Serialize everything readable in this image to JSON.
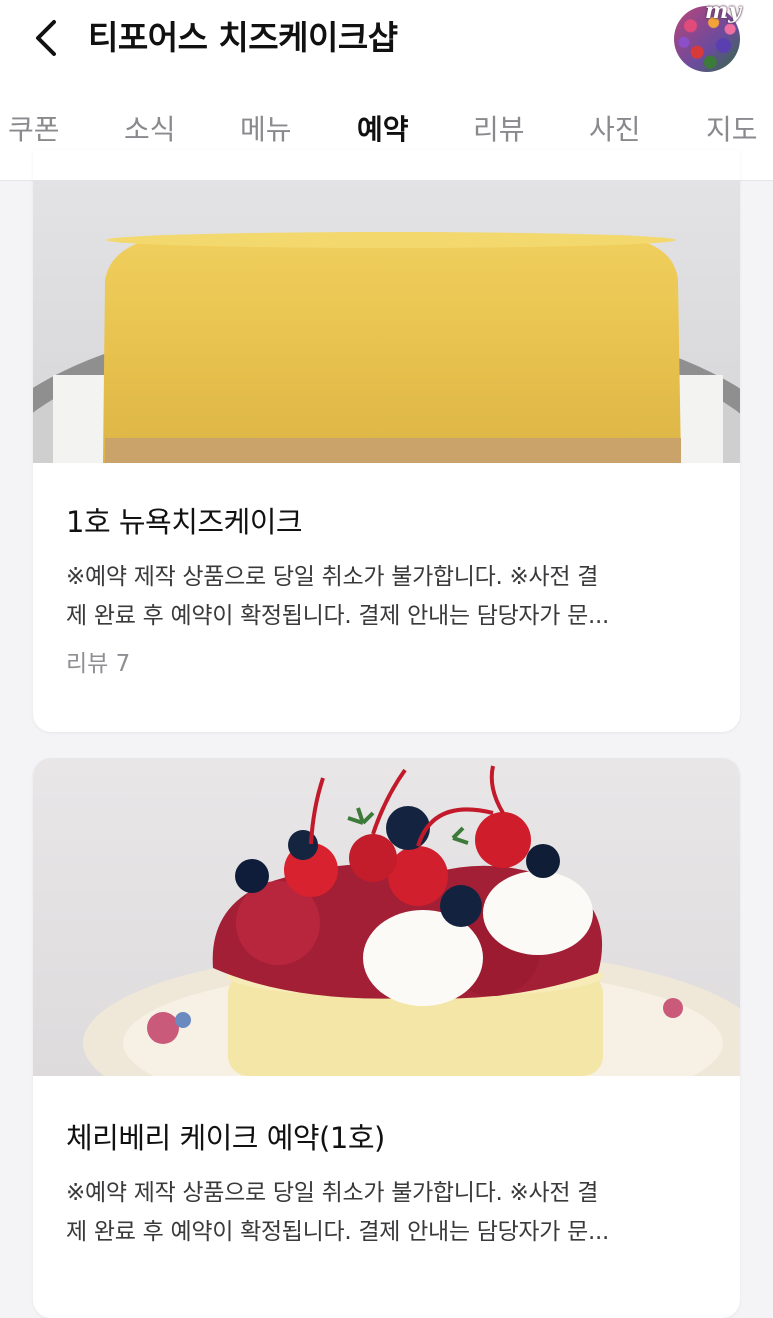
{
  "header": {
    "title": "티포어스 치즈케이크샵",
    "back_icon": "chevron-left-icon",
    "my_label": "my"
  },
  "tabs": [
    {
      "label": "쿠폰",
      "active": false
    },
    {
      "label": "소식",
      "active": false
    },
    {
      "label": "메뉴",
      "active": false
    },
    {
      "label": "예약",
      "active": true
    },
    {
      "label": "리뷰",
      "active": false
    },
    {
      "label": "사진",
      "active": false
    },
    {
      "label": "지도",
      "active": false
    }
  ],
  "products": [
    {
      "name": "1호 뉴욕치즈케이크",
      "desc_line1": "※예약 제작 상품으로 당일 취소가 불가합니다. ※사전 결",
      "desc_line2": "제 완료 후 예약이 확정됩니다. 결제 안내는 담당자가 문...",
      "review": "리뷰 7"
    },
    {
      "name": "체리베리 케이크 예약(1호)",
      "desc_line1": "※예약 제작 상품으로 당일 취소가 불가합니다. ※사전 결",
      "desc_line2": "제 완료 후 예약이 확정됩니다. 결제 안내는 담당자가 문..."
    }
  ],
  "colors": {
    "active_tab": "#111111",
    "inactive_tab": "#8a8a8e",
    "background": "#f4f4f6"
  }
}
